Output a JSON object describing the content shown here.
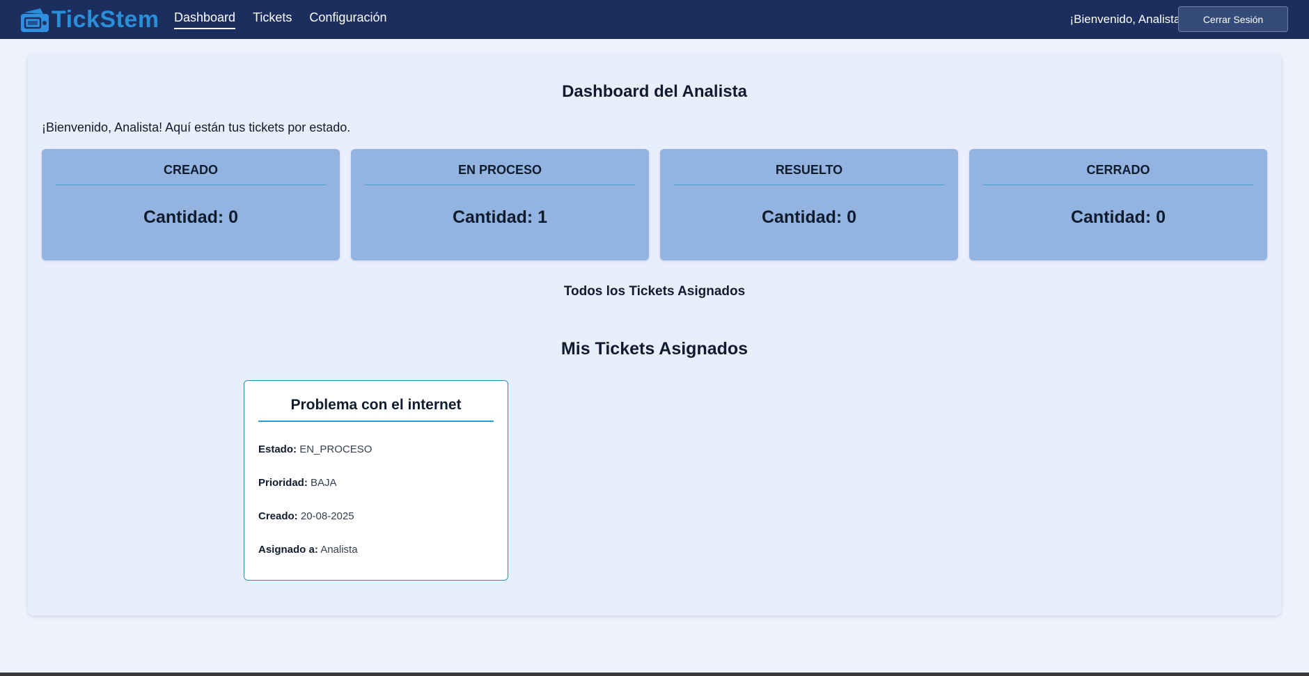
{
  "brand": {
    "name": "TickStem",
    "accent": "#2a8fd9"
  },
  "nav": {
    "links": [
      {
        "label": "Dashboard",
        "active": true
      },
      {
        "label": "Tickets",
        "active": false
      },
      {
        "label": "Configuración",
        "active": false
      }
    ],
    "welcome": "¡Bienvenido, Analista!",
    "logout_label": "Cerrar Sesión"
  },
  "dashboard": {
    "title": "Dashboard del Analista",
    "welcome_message": "¡Bienvenido, Analista! Aquí están tus tickets por estado.",
    "stats": [
      {
        "status": "CREADO",
        "count_text": "Cantidad: 0"
      },
      {
        "status": "EN PROCESO",
        "count_text": "Cantidad: 1"
      },
      {
        "status": "RESUELTO",
        "count_text": "Cantidad: 0"
      },
      {
        "status": "CERRADO",
        "count_text": "Cantidad: 0"
      }
    ],
    "all_tickets_title": "Todos los Tickets Asignados",
    "my_tickets_title": "Mis Tickets Asignados"
  },
  "tickets": [
    {
      "title": "Problema con el internet",
      "fields": [
        {
          "label": "Estado:",
          "value": "EN_PROCESO"
        },
        {
          "label": "Prioridad:",
          "value": "BAJA"
        },
        {
          "label": "Creado:",
          "value": "20-08-2025"
        },
        {
          "label": "Asignado a:",
          "value": "Analista"
        }
      ]
    }
  ]
}
